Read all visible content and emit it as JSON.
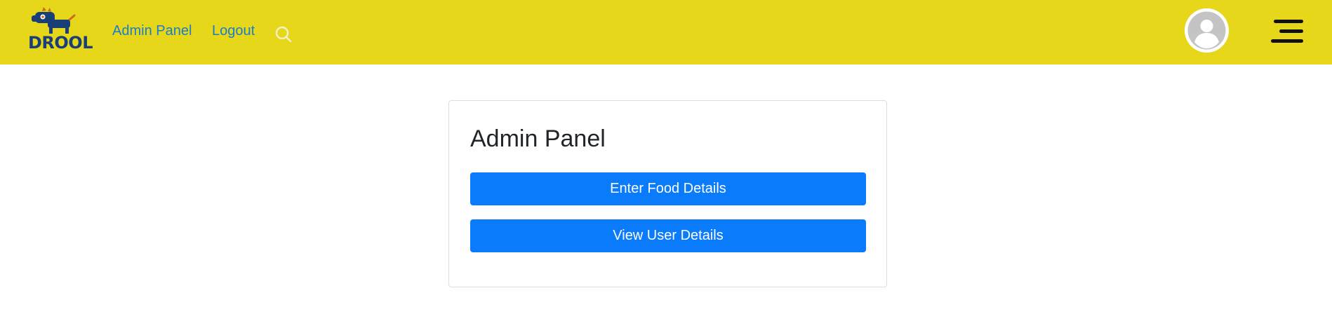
{
  "navbar": {
    "logo_text": "DROOL",
    "links": {
      "admin_panel": "Admin Panel",
      "logout": "Logout"
    },
    "icons": {
      "search": "search-icon",
      "avatar": "user-avatar-icon",
      "menu": "hamburger-menu-icon"
    }
  },
  "card": {
    "title": "Admin Panel",
    "buttons": {
      "enter_food": "Enter Food Details",
      "view_users": "View User Details"
    }
  },
  "colors": {
    "navbar_bg": "#e6d71a",
    "link": "#1a7ec8",
    "primary_button": "#0a7bfb",
    "logo": "#1a3e77"
  }
}
